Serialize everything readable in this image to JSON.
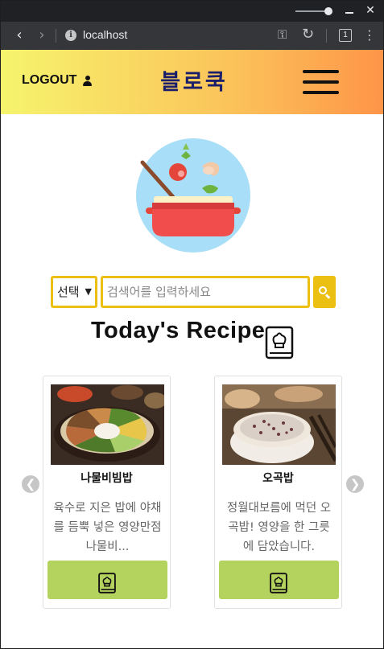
{
  "browser": {
    "url": "localhost",
    "tab_count": "1"
  },
  "header": {
    "logout_label": "LOGOUT",
    "brand": "블로쿡"
  },
  "search": {
    "select_value": "선택",
    "placeholder": "검색어를 입력하세요"
  },
  "section_title": "Today's Recipe",
  "recipes": [
    {
      "name": "나물비빔밥",
      "description": "육수로 지은 밥에 야채를 듬뿍 넣은 영양만점 나물비..."
    },
    {
      "name": "오곡밥",
      "description": "정월대보름에 먹던 오곡밥! 영양을 한 그릇에 담았습니다."
    }
  ],
  "colors": {
    "accent_yellow": "#ecc013",
    "button_green": "#b4d35e",
    "brand_navy": "#1b1f6b"
  },
  "icons": {
    "user": "user-icon",
    "menu": "hamburger-icon",
    "search": "search-icon",
    "recipe_book": "recipe-book-icon",
    "prev": "chevron-left-icon",
    "next": "chevron-right-icon"
  }
}
